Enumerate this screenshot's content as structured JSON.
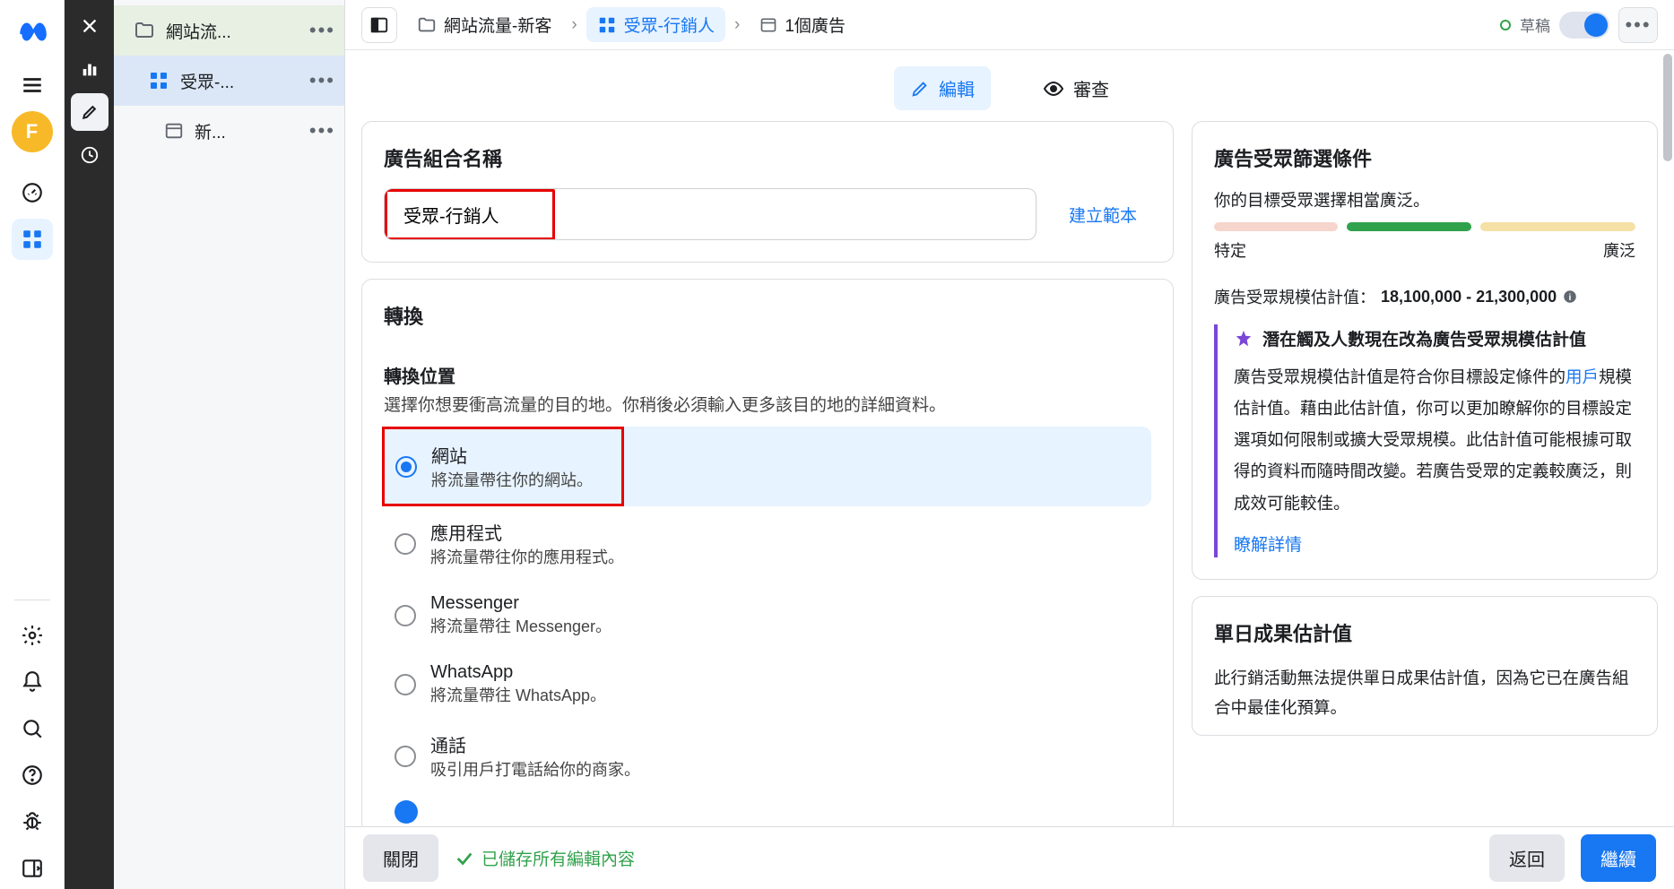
{
  "rail": {
    "avatar_letter": "F"
  },
  "tree": {
    "items": [
      {
        "label": "網站流..."
      },
      {
        "label": "受眾-..."
      },
      {
        "label": "新..."
      }
    ]
  },
  "breadcrumb": {
    "c1": "網站流量-新客",
    "c2": "受眾-行銷人",
    "c3": "1個廣告"
  },
  "status": {
    "label": "草稿"
  },
  "tabs": {
    "edit": "編輯",
    "review": "審查"
  },
  "adset_name_card": {
    "title": "廣告組合名稱",
    "value": "受眾-行銷人",
    "template_link": "建立範本"
  },
  "conversion_card": {
    "title": "轉換",
    "loc_title": "轉換位置",
    "loc_desc": "選擇你想要衝高流量的目的地。你稍後必須輸入更多該目的地的詳細資料。",
    "options": [
      {
        "t1": "網站",
        "t2": "將流量帶往你的網站。"
      },
      {
        "t1": "應用程式",
        "t2": "將流量帶往你的應用程式。"
      },
      {
        "t1": "Messenger",
        "t2": "將流量帶往 Messenger。"
      },
      {
        "t1": "WhatsApp",
        "t2": "將流量帶往 WhatsApp。"
      },
      {
        "t1": "通話",
        "t2": "吸引用戶打電話給你的商家。"
      }
    ]
  },
  "audience_card": {
    "title": "廣告受眾篩選條件",
    "subtitle": "你的目標受眾選擇相當廣泛。",
    "scale_left": "特定",
    "scale_right": "廣泛",
    "est_label": "廣告受眾規模估計值：",
    "est_value": "18,100,000 - 21,300,000",
    "callout_title": "潛在觸及人數現在改為廣告受眾規模估計值",
    "callout_body_pre": "廣告受眾規模估計值是符合你目標設定條件的",
    "callout_body_link": "用戶",
    "callout_body_post": "規模估計值。藉由此估計值，你可以更加瞭解你的目標設定選項如何限制或擴大受眾規模。此估計值可能根據可取得的資料而隨時間改變。若廣告受眾的定義較廣泛，則成效可能較佳。",
    "learn_more": "瞭解詳情"
  },
  "daily_card": {
    "title": "單日成果估計值",
    "body": "此行銷活動無法提供單日成果估計值，因為它已在廣告組合中最佳化預算。"
  },
  "footer": {
    "close": "關閉",
    "saved": "已儲存所有編輯內容",
    "back": "返回",
    "continue": "繼續"
  }
}
